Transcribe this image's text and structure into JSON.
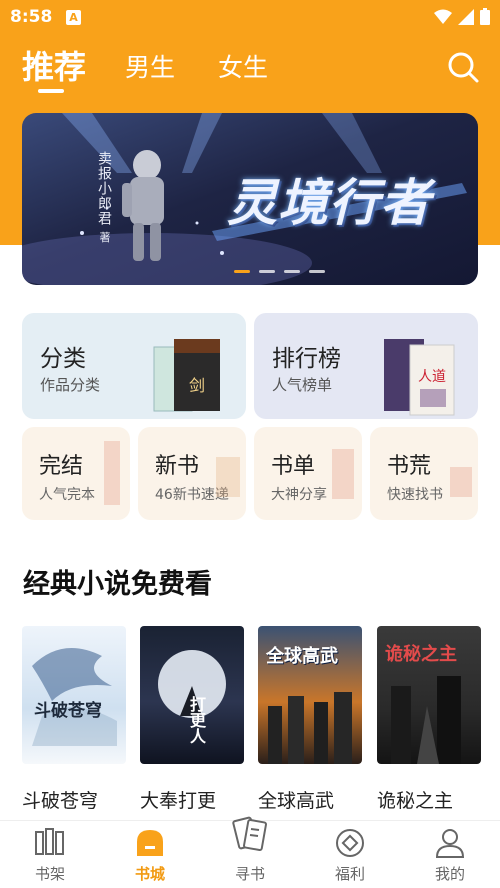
{
  "status_bar": {
    "time": "8:58",
    "notification_icon": "A",
    "icons": [
      "wifi-icon",
      "signal-icon",
      "battery-icon"
    ]
  },
  "top_tabs": [
    {
      "label": "推荐",
      "active": true
    },
    {
      "label": "男生",
      "active": false
    },
    {
      "label": "女生",
      "active": false
    }
  ],
  "banner": {
    "author": "卖报小郎君",
    "author_suffix": "著",
    "title": "灵境行者",
    "dots": 4,
    "active_dot": 0
  },
  "feature_cards": [
    {
      "title": "分类",
      "subtitle": "作品分类",
      "bg": "#e4eef4"
    },
    {
      "title": "排行榜",
      "subtitle": "人气榜单",
      "bg": "#e4e7f3"
    }
  ],
  "small_cards": [
    {
      "title": "完结",
      "subtitle": "人气完本"
    },
    {
      "title": "新书",
      "subtitle": "46新书速递"
    },
    {
      "title": "书单",
      "subtitle": "大神分享"
    },
    {
      "title": "书荒",
      "subtitle": "快速找书"
    }
  ],
  "section": {
    "title": "经典小说免费看"
  },
  "books": [
    {
      "name": "斗破苍穹",
      "cover_title": "斗破苍穹"
    },
    {
      "name": "大奉打更",
      "cover_title": "打更人"
    },
    {
      "name": "全球高武",
      "cover_title": "全球高武"
    },
    {
      "name": "诡秘之主",
      "cover_title": "诡秘之主"
    }
  ],
  "bottom_nav": [
    {
      "label": "书架",
      "icon": "bookshelf-icon",
      "active": false
    },
    {
      "label": "书城",
      "icon": "bookstore-icon",
      "active": true
    },
    {
      "label": "寻书",
      "icon": "find-book-icon",
      "active": false
    },
    {
      "label": "福利",
      "icon": "welfare-icon",
      "active": false
    },
    {
      "label": "我的",
      "icon": "profile-icon",
      "active": false
    }
  ],
  "colors": {
    "accent": "#f9a21a",
    "nav_active": "#f29a12"
  }
}
